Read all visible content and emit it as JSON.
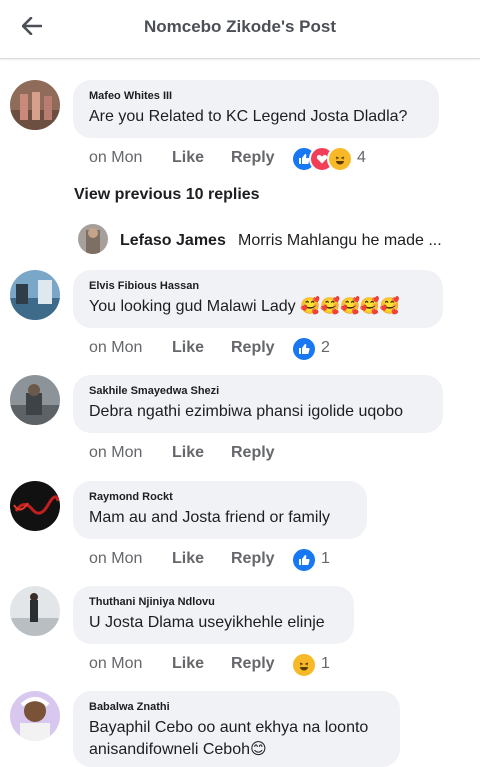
{
  "header": {
    "title": "Nomcebo Zikode's Post",
    "ghost_text": ", ·"
  },
  "view_previous": "View previous 10 replies",
  "inline_reply": {
    "name": "Lefaso James",
    "text": "Morris Mahlangu he made ..."
  },
  "comments": [
    {
      "author": "Mafeo Whites III",
      "text": "Are you Related to KC Legend Josta Dladla?",
      "time": "on Mon",
      "like": "Like",
      "reply": "Reply",
      "reaction_count": "4",
      "reactions": [
        "like-icon",
        "love-icon",
        "haha-icon"
      ]
    },
    {
      "author": "Elvis Fibious Hassan",
      "text": "You looking gud Malawi Lady 🥰🥰🥰🥰🥰",
      "time": "on Mon",
      "like": "Like",
      "reply": "Reply",
      "reaction_count": "2",
      "reactions": [
        "like-icon"
      ]
    },
    {
      "author": "Sakhile Smayedwa Shezi",
      "text": "Debra ngathi ezimbiwa phansi igolide uqobo",
      "time": "on Mon",
      "like": "Like",
      "reply": "Reply"
    },
    {
      "author": "Raymond Rockt",
      "text": "Mam au and Josta friend or family",
      "time": "on Mon",
      "like": "Like",
      "reply": "Reply",
      "reaction_count": "1",
      "reactions": [
        "like-icon"
      ]
    },
    {
      "author": "Thuthani Njiniya Ndlovu",
      "text": "U Josta Dlama useyikhehle elinje",
      "time": "on Mon",
      "like": "Like",
      "reply": "Reply",
      "reaction_count": "1",
      "reactions": [
        "haha-icon"
      ]
    },
    {
      "author": "Babalwa Znathi",
      "text_line1": "Bayaphil Cebo oo aunt ekhya na loonto",
      "text_line2": "anisandifowneli Ceboh😊"
    }
  ],
  "colors": {
    "like_blue": "#1877f2",
    "love_red": "#f33e58",
    "haha_yellow": "#f7b928",
    "meta_gray": "#65676b"
  }
}
